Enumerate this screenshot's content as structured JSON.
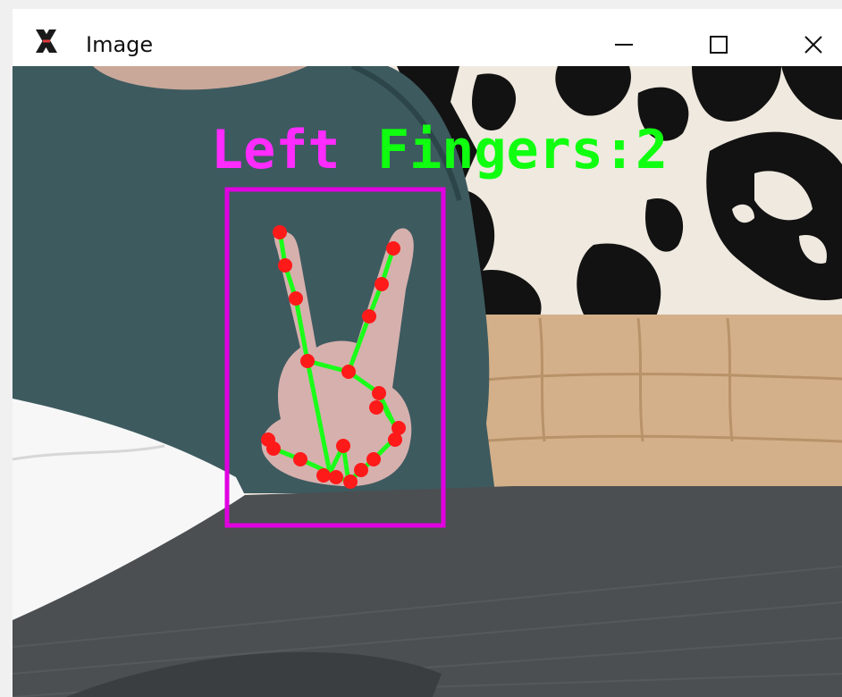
{
  "window": {
    "title": "Image",
    "app_icon": "x-window-icon",
    "controls": {
      "minimize_icon": "minimize-icon",
      "maximize_icon": "maximize-icon",
      "close_icon": "close-icon"
    }
  },
  "overlay": {
    "handedness_label": "Left",
    "fingers_label": "Fingers:2",
    "handedness_color": "#ff2bff",
    "fingers_color": "#10ff10",
    "box_color": "#e000e0",
    "landmark_color": "#ff1a1a",
    "connection_color": "#1aff1a"
  },
  "scene": {
    "sofa_color": "#d7b48a",
    "wallpaper_color": "#f3efe6",
    "wallpaper_pattern_color": "#121212",
    "shirt_color": "#3e5b60",
    "table_color": "#4c5053",
    "paper_color": "#f8f8f8"
  }
}
